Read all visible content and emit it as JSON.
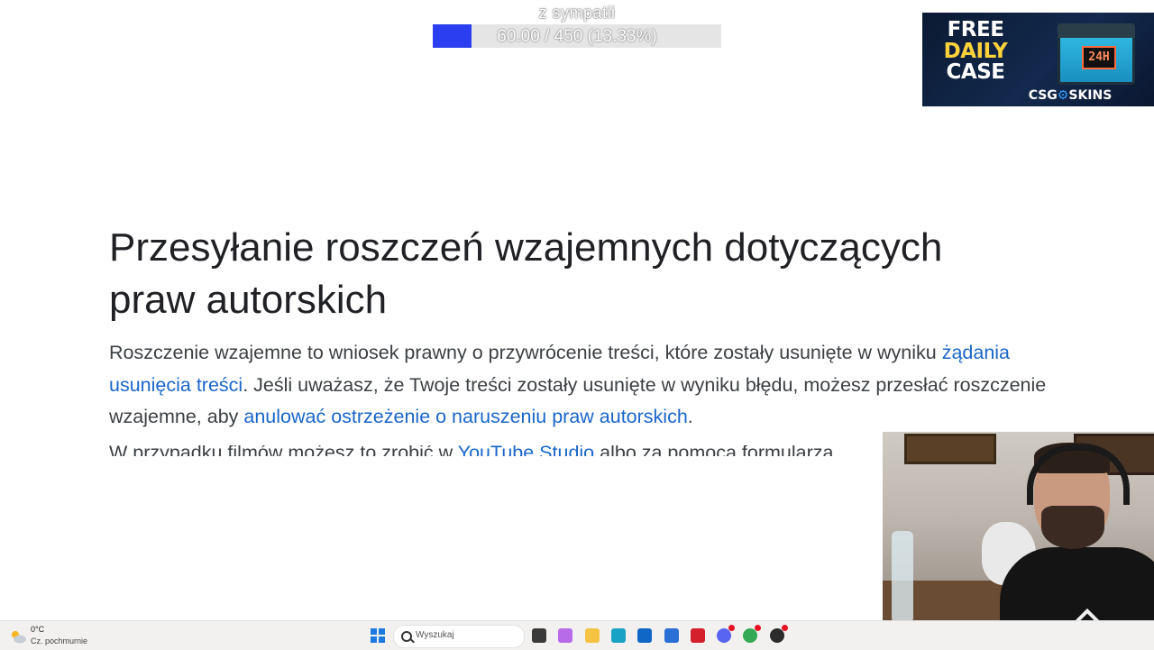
{
  "overlay": {
    "goal_title": "z sympatii",
    "goal_text": "60.00 / 450 (13.33%)",
    "goal_progress": 0.1333,
    "goal_fill_color": "#2b3ff0"
  },
  "ad": {
    "line1": "FREE",
    "line2": "DAILY",
    "line3": "CASE",
    "case_badge": "24H",
    "brand_left": "CSG",
    "brand_right": "SKINS"
  },
  "article": {
    "heading_line1": "Przesyłanie roszczeń wzajemnych dotyczących",
    "heading_line2": "praw autorskich",
    "p_text1": "Roszczenie wzajemne to wniosek prawny o przywrócenie treści, które zostały usunięte w wyniku ",
    "p_link1": "żądania usunięcia treści",
    "p_text2": ". Jeśli uważasz, że Twoje treści zostały usunięte w wyniku błędu, możesz przesłać roszczenie wzajemne, aby ",
    "p_link2": "anulować ostrzeżenie o naruszeniu praw autorskich",
    "p_text3": ".",
    "cut_text": "W przypadku filmów możesz to zrobić w ",
    "cut_link": "YouTube Studio",
    "cut_text2": " albo za pomocą formularza"
  },
  "taskbar": {
    "weather_temp": "0°C",
    "weather_desc": "Cz. pochmurnie",
    "search_placeholder": "Wyszukaj",
    "apps": [
      {
        "name": "file-explorer-dark-icon",
        "color": "#3a3a3a"
      },
      {
        "name": "copilot-icon",
        "color": "#b86be8"
      },
      {
        "name": "folder-icon",
        "color": "#f5c242"
      },
      {
        "name": "edge-icon",
        "color": "#1aa2c4"
      },
      {
        "name": "outlook-icon",
        "color": "#1167c6"
      },
      {
        "name": "store-icon",
        "color": "#2a6fd6"
      },
      {
        "name": "red-app-icon",
        "color": "#d3202c"
      },
      {
        "name": "discord-icon",
        "color": "#5865f2"
      },
      {
        "name": "chrome-icon",
        "color": "#34a853"
      },
      {
        "name": "obs-icon",
        "color": "#2b2b2b"
      }
    ]
  }
}
